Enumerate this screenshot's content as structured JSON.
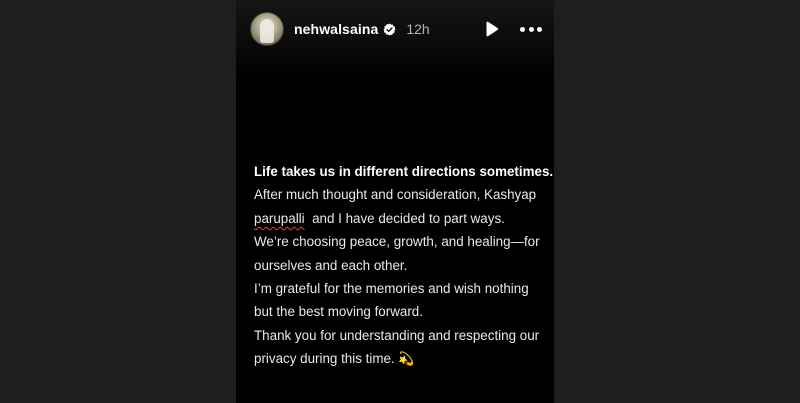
{
  "story": {
    "username": "nehwalsaina",
    "time": "12h",
    "verified_icon": "verified-badge-icon",
    "play_icon": "play-icon",
    "more_icon": "more-options-icon",
    "text": {
      "headline": "Life takes us in different directions sometimes.",
      "line1": "After much thought and consideration, Kashyap",
      "line2_word": "parupalli",
      "line2_rest": "  and I have decided to part ways.",
      "line3": "We’re choosing peace, growth, and healing—for",
      "line4": "ourselves and each other.",
      "line5": "I’m grateful for the memories and wish nothing",
      "line6": "but the best moving forward.",
      "line7": "Thank you for understanding and respecting our",
      "line8": "privacy during this time.",
      "emoji": "💫"
    }
  },
  "colors": {
    "page_background": "#1e1e1e",
    "story_background": "#000000",
    "text": "#e9e9e9",
    "misspelling_underline": "#e0403a"
  }
}
